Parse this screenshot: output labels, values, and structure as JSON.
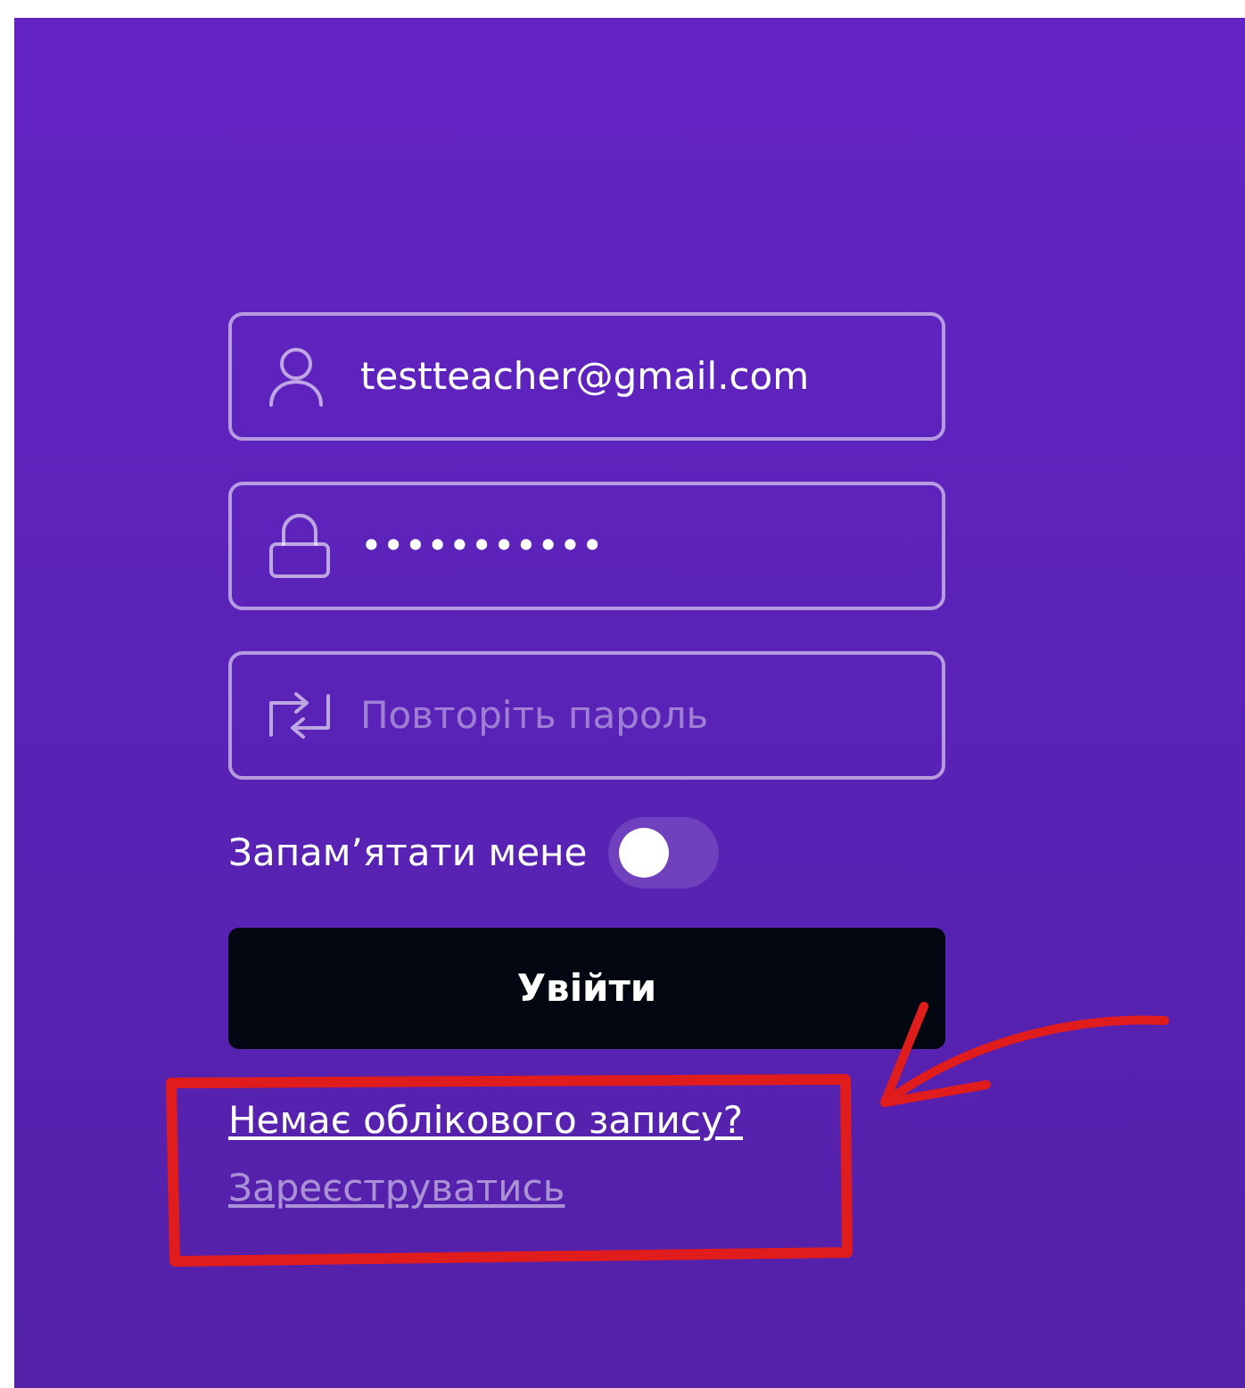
{
  "fields": [
    {
      "kind": "user",
      "value": "testteacher@gmail.com"
    },
    {
      "kind": "lock",
      "value": "•••••••••••"
    },
    {
      "kind": "repeat",
      "placeholder": "Повторіть пароль"
    }
  ],
  "remember": {
    "label": "Запам’ятати мене",
    "on": false
  },
  "submit": {
    "label": "Увійти"
  },
  "links": [
    {
      "label": "Немає облікового запису?",
      "muted": false
    },
    {
      "label": "Зареєструватись",
      "muted": true
    }
  ]
}
